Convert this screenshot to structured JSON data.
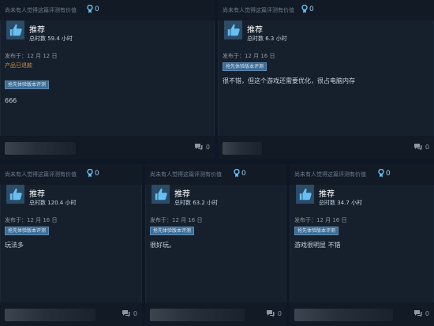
{
  "reviews": [
    {
      "helpful_text": "尚未有人觉得这篇评测有价值",
      "award_count": "0",
      "recommendation": "推荐",
      "hours": "总时数 59.4 小时",
      "posted": "发布于：12 月 12 日",
      "refunded": "产品已退款",
      "tag": "抢先体验版本评测",
      "text": "666",
      "comment_count": "0"
    },
    {
      "helpful_text": "尚未有人觉得这篇评测有价值",
      "award_count": "0",
      "recommendation": "推荐",
      "hours": "总时数 6.3 小时",
      "posted": "发布于：12 月 16 日",
      "tag": "抢先体验版本评测",
      "text": "很不错，但这个游戏还需要优化，很占电脑内存",
      "comment_count": "0"
    },
    {
      "helpful_text": "尚未有人觉得这篇评测有价值",
      "award_count": "0",
      "recommendation": "推荐",
      "hours": "总时数 120.4 小时",
      "posted": "发布于：12 月 16 日",
      "tag": "抢先体验版本评测",
      "text": "玩法多",
      "comment_count": "0"
    },
    {
      "helpful_text": "尚未有人觉得这篇评测有价值",
      "award_count": "0",
      "recommendation": "推荐",
      "hours": "总时数 63.2 小时",
      "posted": "发布于：12 月 16 日",
      "tag": "抢先体验版本评测",
      "text": "很好玩。",
      "comment_count": "0"
    },
    {
      "helpful_text": "尚未有人觉得这篇评测有价值",
      "award_count": "0",
      "recommendation": "推荐",
      "hours": "总时数 34.7 小时",
      "posted": "发布于：12 月 16 日",
      "tag": "抢先体验版本评测",
      "text": "游戏很明显 不错",
      "comment_count": "0"
    }
  ],
  "colors": {
    "page_bg": "#0e1726",
    "card_bg": "#16202d",
    "tag_bg": "#3d6c95",
    "refunded": "#c98a47",
    "thumb_icon": "#66c0f4"
  },
  "icons": {
    "award": "award-ribbon-icon",
    "recommend": "thumbs-up-icon",
    "comments": "speech-bubble-icon"
  }
}
